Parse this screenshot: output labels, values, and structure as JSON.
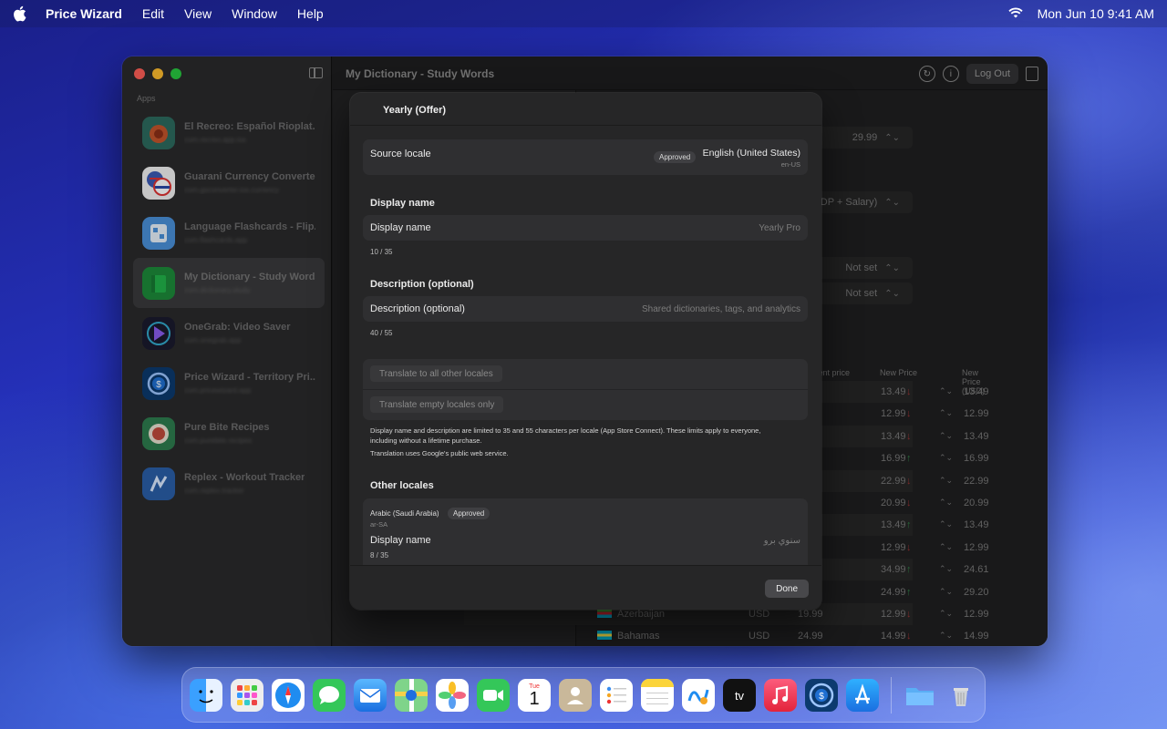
{
  "menubar": {
    "app_name": "Price Wizard",
    "items": [
      "Edit",
      "View",
      "Window",
      "Help"
    ],
    "datetime": "Mon Jun 10  9:41 AM"
  },
  "window": {
    "title": "My Dictionary - Study Words",
    "logout_label": "Log Out",
    "sidebar_section": "Apps",
    "apps": [
      {
        "name": "El Recreo: Español Rioplat...",
        "sub": "com.recreo.app.ios"
      },
      {
        "name": "Guarani Currency Converter",
        "sub": "com.gsconverter.ios.currency"
      },
      {
        "name": "Language Flashcards - Flip...",
        "sub": "com.flashcards.app"
      },
      {
        "name": "My Dictionary - Study Words",
        "sub": "com.dictionary.study"
      },
      {
        "name": "OneGrab: Video Saver",
        "sub": "com.onegrab.app"
      },
      {
        "name": "Price Wizard - Territory Pri...",
        "sub": "com.pricewizard.app"
      },
      {
        "name": "Pure Bite Recipes",
        "sub": "com.purebite.recipes"
      },
      {
        "name": "Replex - Workout Tracker",
        "sub": "com.replex.tracker"
      }
    ],
    "settings": {
      "base_price": "29.99",
      "strategy": "Custom (GDP + Salary)",
      "setting_a": "Not set",
      "setting_b": "Not set"
    },
    "table": {
      "headers": {
        "current": "Current price",
        "new": "New Price",
        "new_usd": "New Price (USD)"
      },
      "rows": [
        {
          "new": "13.49",
          "dir": "down",
          "usd": "13.49"
        },
        {
          "new": "12.99",
          "dir": "down",
          "usd": "12.99"
        },
        {
          "new": "13.49",
          "dir": "down",
          "usd": "13.49"
        },
        {
          "new": "16.99",
          "dir": "up",
          "usd": "16.99"
        },
        {
          "new": "22.99",
          "dir": "down",
          "usd": "22.99"
        },
        {
          "new": "20.99",
          "dir": "down",
          "usd": "20.99"
        },
        {
          "new": "13.49",
          "dir": "up",
          "usd": "13.49"
        },
        {
          "new": "12.99",
          "dir": "down",
          "usd": "12.99"
        },
        {
          "new": "34.99",
          "dir": "up",
          "usd": "24.61"
        },
        {
          "new": "24.99",
          "dir": "up",
          "usd": "29.20"
        },
        {
          "country": "Azerbaijan",
          "currency": "USD",
          "current": "19.99",
          "new": "12.99",
          "dir": "down",
          "usd": "12.99"
        },
        {
          "country": "Bahamas",
          "currency": "USD",
          "current": "24.99",
          "new": "14.99",
          "dir": "down",
          "usd": "14.99"
        }
      ]
    }
  },
  "sheet": {
    "title": "Yearly (Offer)",
    "source_locale_label": "Source locale",
    "source_status": "Approved",
    "source_locale_name": "English (United States)",
    "source_locale_code": "en-US",
    "display_name_section": "Display name",
    "display_name_label": "Display name",
    "display_name_value": "Yearly Pro",
    "display_name_count": "10 / 35",
    "description_section": "Description (optional)",
    "description_label": "Description (optional)",
    "description_value": "Shared dictionaries, tags, and analytics",
    "description_count": "40 / 55",
    "translate_all": "Translate to all other locales",
    "translate_empty": "Translate empty locales only",
    "note_1": "Display name and description are limited to 35 and 55 characters per locale (App Store Connect). These limits apply to everyone, including without a lifetime purchase.",
    "note_2": "Translation uses Google's public web service.",
    "other_locales_section": "Other locales",
    "other_locale": {
      "name": "Arabic (Saudi Arabia)",
      "status": "Approved",
      "code": "ar-SA",
      "display_name_label": "Display name",
      "display_name_value": "سنوي برو",
      "count": "8 / 35"
    },
    "done_label": "Done"
  },
  "dock": [
    "Finder",
    "Launchpad",
    "Safari",
    "Messages",
    "Mail",
    "Maps",
    "Photos",
    "FaceTime",
    "Calendar",
    "Contacts",
    "Reminders",
    "Notes",
    "Freeform",
    "TV",
    "Music",
    "Price Wizard",
    "App Store",
    "Downloads",
    "Trash"
  ],
  "calendar": {
    "month": "Tue",
    "day": "1"
  },
  "colors": {
    "accent_up": "#2f7d44",
    "accent_down": "#9a3232",
    "sheet_bg": "#262627"
  }
}
